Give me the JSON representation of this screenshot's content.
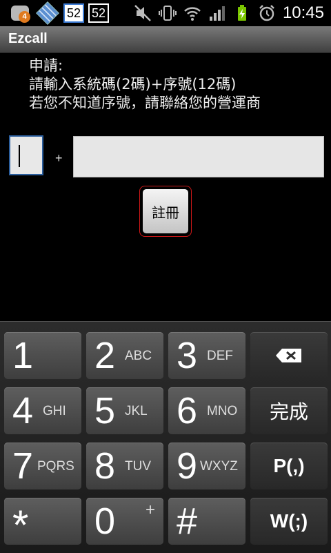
{
  "status_bar": {
    "badge_count": "4",
    "box_a": "52",
    "box_b": "52",
    "time": "10:45",
    "icons": [
      "app-icon",
      "diamond-app-icon",
      "mute-icon",
      "vibrate-icon",
      "wifi-icon",
      "signal-icon",
      "battery-charging-icon",
      "alarm-icon"
    ]
  },
  "app": {
    "title": "Ezcall"
  },
  "instructions": {
    "line1": "申請:",
    "line2": "請輸入系統碼(2碼)+序號(12碼)",
    "line3": "若您不知道序號，請聯絡您的營運商"
  },
  "form": {
    "code_value": "",
    "plus": "+",
    "serial_value": "",
    "register_label": "註冊"
  },
  "keypad": {
    "keys": [
      {
        "digit": "1",
        "letters": ""
      },
      {
        "digit": "2",
        "letters": "ABC"
      },
      {
        "digit": "3",
        "letters": "DEF"
      },
      {
        "digit": "4",
        "letters": "GHI"
      },
      {
        "digit": "5",
        "letters": "JKL"
      },
      {
        "digit": "6",
        "letters": "MNO"
      },
      {
        "digit": "7",
        "letters": "PQRS"
      },
      {
        "digit": "8",
        "letters": "TUV"
      },
      {
        "digit": "9",
        "letters": "WXYZ"
      },
      {
        "digit": "*",
        "letters": ""
      },
      {
        "digit": "0",
        "letters": "+"
      },
      {
        "digit": "#",
        "letters": ""
      }
    ],
    "done_label": "完成",
    "pause_label": "P(,)",
    "wait_label": "W(;)"
  },
  "colors": {
    "focus_border": "#2c5f9e",
    "register_border": "#d01818",
    "badge": "#e07a1e"
  }
}
